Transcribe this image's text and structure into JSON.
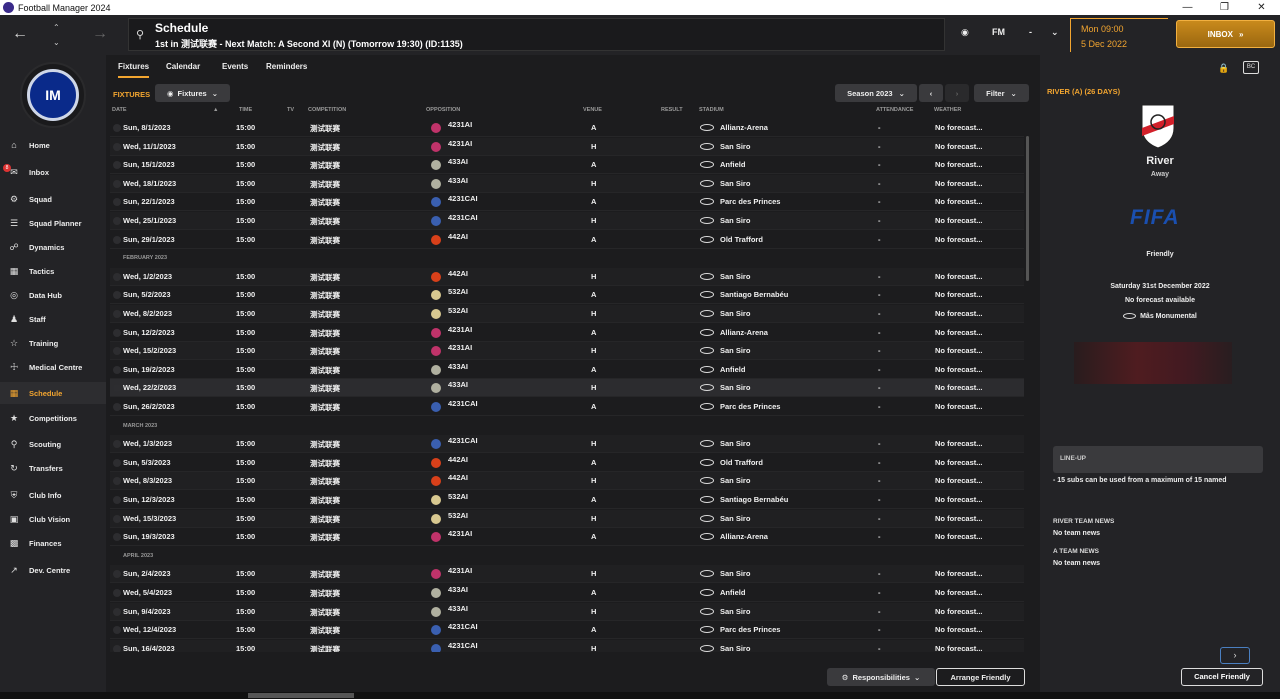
{
  "window": {
    "title": "Football Manager 2024"
  },
  "header": {
    "title": "Schedule",
    "subtitle": "1st in 测试联赛 - Next Match: A Second XI (N) (Tomorrow 19:30) (ID:1135)",
    "fm_label": "FM",
    "dash": "-",
    "time": "Mon 09:00",
    "date": "5 Dec 2022",
    "inbox_label": "INBOX"
  },
  "sidebar": {
    "items": [
      {
        "label": "Home"
      },
      {
        "label": "Inbox"
      },
      {
        "label": "Squad"
      },
      {
        "label": "Squad Planner"
      },
      {
        "label": "Dynamics"
      },
      {
        "label": "Tactics"
      },
      {
        "label": "Data Hub"
      },
      {
        "label": "Staff"
      },
      {
        "label": "Training"
      },
      {
        "label": "Medical Centre"
      },
      {
        "label": "Schedule"
      },
      {
        "label": "Competitions"
      },
      {
        "label": "Scouting"
      },
      {
        "label": "Transfers"
      },
      {
        "label": "Club Info"
      },
      {
        "label": "Club Vision"
      },
      {
        "label": "Finances"
      },
      {
        "label": "Dev. Centre"
      }
    ],
    "inbox_count": "8"
  },
  "tabs": [
    {
      "label": "Fixtures"
    },
    {
      "label": "Calendar"
    },
    {
      "label": "Events"
    },
    {
      "label": "Reminders"
    }
  ],
  "main": {
    "section_label": "FIXTURES",
    "fixtures_dropdown": "Fixtures",
    "season": "Season 2023",
    "filter": "Filter",
    "columns": {
      "date": "DATE",
      "time": "TIME",
      "tv": "TV",
      "competition": "COMPETITION",
      "opposition": "OPPOSITION",
      "venue": "VENUE",
      "result": "RESULT",
      "stadium": "STADIUM",
      "attendance": "ATTENDANCE",
      "weather": "WEATHER"
    },
    "rows": [
      {
        "type": "fixture",
        "date": "Sun, 8/1/2023",
        "time": "15:00",
        "comp": "测试联赛",
        "opp": "4231AI",
        "venue": "A",
        "stadium": "Allianz-Arena",
        "att": "-",
        "weather": "No forecast...",
        "crest": "#c0336a"
      },
      {
        "type": "fixture",
        "date": "Wed, 11/1/2023",
        "time": "15:00",
        "comp": "测试联赛",
        "opp": "4231AI",
        "venue": "H",
        "stadium": "San Siro",
        "att": "-",
        "weather": "No forecast...",
        "crest": "#c0336a"
      },
      {
        "type": "fixture",
        "date": "Sun, 15/1/2023",
        "time": "15:00",
        "comp": "测试联赛",
        "opp": "433AI",
        "venue": "A",
        "stadium": "Anfield",
        "att": "-",
        "weather": "No forecast...",
        "crest": "#b0b0a0"
      },
      {
        "type": "fixture",
        "date": "Wed, 18/1/2023",
        "time": "15:00",
        "comp": "测试联赛",
        "opp": "433AI",
        "venue": "H",
        "stadium": "San Siro",
        "att": "-",
        "weather": "No forecast...",
        "crest": "#b0b0a0"
      },
      {
        "type": "fixture",
        "date": "Sun, 22/1/2023",
        "time": "15:00",
        "comp": "测试联赛",
        "opp": "4231CAI",
        "venue": "A",
        "stadium": "Parc des Princes",
        "att": "-",
        "weather": "No forecast...",
        "crest": "#3a5fb0"
      },
      {
        "type": "fixture",
        "date": "Wed, 25/1/2023",
        "time": "15:00",
        "comp": "测试联赛",
        "opp": "4231CAI",
        "venue": "H",
        "stadium": "San Siro",
        "att": "-",
        "weather": "No forecast...",
        "crest": "#3a5fb0"
      },
      {
        "type": "fixture",
        "date": "Sun, 29/1/2023",
        "time": "15:00",
        "comp": "测试联赛",
        "opp": "442AI",
        "venue": "A",
        "stadium": "Old Trafford",
        "att": "-",
        "weather": "No forecast...",
        "crest": "#d8401a"
      },
      {
        "type": "month",
        "label": "FEBRUARY 2023"
      },
      {
        "type": "fixture",
        "date": "Wed, 1/2/2023",
        "time": "15:00",
        "comp": "测试联赛",
        "opp": "442AI",
        "venue": "H",
        "stadium": "San Siro",
        "att": "-",
        "weather": "No forecast...",
        "crest": "#d8401a"
      },
      {
        "type": "fixture",
        "date": "Sun, 5/2/2023",
        "time": "15:00",
        "comp": "测试联赛",
        "opp": "532AI",
        "venue": "A",
        "stadium": "Santiago Bernabéu",
        "att": "-",
        "weather": "No forecast...",
        "crest": "#d8c890"
      },
      {
        "type": "fixture",
        "date": "Wed, 8/2/2023",
        "time": "15:00",
        "comp": "测试联赛",
        "opp": "532AI",
        "venue": "H",
        "stadium": "San Siro",
        "att": "-",
        "weather": "No forecast...",
        "crest": "#d8c890"
      },
      {
        "type": "fixture",
        "date": "Sun, 12/2/2023",
        "time": "15:00",
        "comp": "测试联赛",
        "opp": "4231AI",
        "venue": "A",
        "stadium": "Allianz-Arena",
        "att": "-",
        "weather": "No forecast...",
        "crest": "#c0336a"
      },
      {
        "type": "fixture",
        "date": "Wed, 15/2/2023",
        "time": "15:00",
        "comp": "测试联赛",
        "opp": "4231AI",
        "venue": "H",
        "stadium": "San Siro",
        "att": "-",
        "weather": "No forecast...",
        "crest": "#c0336a"
      },
      {
        "type": "fixture",
        "date": "Sun, 19/2/2023",
        "time": "15:00",
        "comp": "测试联赛",
        "opp": "433AI",
        "venue": "A",
        "stadium": "Anfield",
        "att": "-",
        "weather": "No forecast...",
        "crest": "#b0b0a0"
      },
      {
        "type": "fixture",
        "date": "Wed, 22/2/2023",
        "time": "15:00",
        "comp": "测试联赛",
        "opp": "433AI",
        "venue": "H",
        "stadium": "San Siro",
        "att": "-",
        "weather": "No forecast...",
        "crest": "#b0b0a0",
        "highlight": true
      },
      {
        "type": "fixture",
        "date": "Sun, 26/2/2023",
        "time": "15:00",
        "comp": "测试联赛",
        "opp": "4231CAI",
        "venue": "A",
        "stadium": "Parc des Princes",
        "att": "-",
        "weather": "No forecast...",
        "crest": "#3a5fb0"
      },
      {
        "type": "month",
        "label": "MARCH 2023"
      },
      {
        "type": "fixture",
        "date": "Wed, 1/3/2023",
        "time": "15:00",
        "comp": "测试联赛",
        "opp": "4231CAI",
        "venue": "H",
        "stadium": "San Siro",
        "att": "-",
        "weather": "No forecast...",
        "crest": "#3a5fb0"
      },
      {
        "type": "fixture",
        "date": "Sun, 5/3/2023",
        "time": "15:00",
        "comp": "测试联赛",
        "opp": "442AI",
        "venue": "A",
        "stadium": "Old Trafford",
        "att": "-",
        "weather": "No forecast...",
        "crest": "#d8401a"
      },
      {
        "type": "fixture",
        "date": "Wed, 8/3/2023",
        "time": "15:00",
        "comp": "测试联赛",
        "opp": "442AI",
        "venue": "H",
        "stadium": "San Siro",
        "att": "-",
        "weather": "No forecast...",
        "crest": "#d8401a"
      },
      {
        "type": "fixture",
        "date": "Sun, 12/3/2023",
        "time": "15:00",
        "comp": "测试联赛",
        "opp": "532AI",
        "venue": "A",
        "stadium": "Santiago Bernabéu",
        "att": "-",
        "weather": "No forecast...",
        "crest": "#d8c890"
      },
      {
        "type": "fixture",
        "date": "Wed, 15/3/2023",
        "time": "15:00",
        "comp": "测试联赛",
        "opp": "532AI",
        "venue": "H",
        "stadium": "San Siro",
        "att": "-",
        "weather": "No forecast...",
        "crest": "#d8c890"
      },
      {
        "type": "fixture",
        "date": "Sun, 19/3/2023",
        "time": "15:00",
        "comp": "测试联赛",
        "opp": "4231AI",
        "venue": "A",
        "stadium": "Allianz-Arena",
        "att": "-",
        "weather": "No forecast...",
        "crest": "#c0336a"
      },
      {
        "type": "month",
        "label": "APRIL 2023"
      },
      {
        "type": "fixture",
        "date": "Sun, 2/4/2023",
        "time": "15:00",
        "comp": "测试联赛",
        "opp": "4231AI",
        "venue": "H",
        "stadium": "San Siro",
        "att": "-",
        "weather": "No forecast...",
        "crest": "#c0336a"
      },
      {
        "type": "fixture",
        "date": "Wed, 5/4/2023",
        "time": "15:00",
        "comp": "测试联赛",
        "opp": "433AI",
        "venue": "A",
        "stadium": "Anfield",
        "att": "-",
        "weather": "No forecast...",
        "crest": "#b0b0a0"
      },
      {
        "type": "fixture",
        "date": "Sun, 9/4/2023",
        "time": "15:00",
        "comp": "测试联赛",
        "opp": "433AI",
        "venue": "H",
        "stadium": "San Siro",
        "att": "-",
        "weather": "No forecast...",
        "crest": "#b0b0a0"
      },
      {
        "type": "fixture",
        "date": "Wed, 12/4/2023",
        "time": "15:00",
        "comp": "测试联赛",
        "opp": "4231CAI",
        "venue": "A",
        "stadium": "Parc des Princes",
        "att": "-",
        "weather": "No forecast...",
        "crest": "#3a5fb0"
      },
      {
        "type": "fixture",
        "date": "Sun, 16/4/2023",
        "time": "15:00",
        "comp": "测试联赛",
        "opp": "4231CAI",
        "venue": "H",
        "stadium": "San Siro",
        "att": "-",
        "weather": "No forecast...",
        "crest": "#3a5fb0"
      }
    ]
  },
  "bottom": {
    "responsibilities": "Responsibilities",
    "arrange_friendly": "Arrange Friendly",
    "cancel_friendly": "Cancel Friendly"
  },
  "right_panel": {
    "title": "RIVER (A) (26 DAYS)",
    "team": "River",
    "venue": "Away",
    "competition_logo": "FIFA",
    "competition": "Friendly",
    "date": "Saturday 31st December 2022",
    "forecast": "No forecast available",
    "stadium": "Mâs Monumental",
    "lineup_title": "LINE-UP",
    "lineup_text": "- 15 subs can be used from a maximum of 15 named",
    "river_news_title": "RIVER TEAM NEWS",
    "river_news": "No team news",
    "a_news_title": "A TEAM NEWS",
    "a_news": "No team news",
    "bc_label": "BC"
  },
  "colors": {
    "accent": "#f2a530",
    "background": "#1c1c1e",
    "panel": "#232326"
  }
}
